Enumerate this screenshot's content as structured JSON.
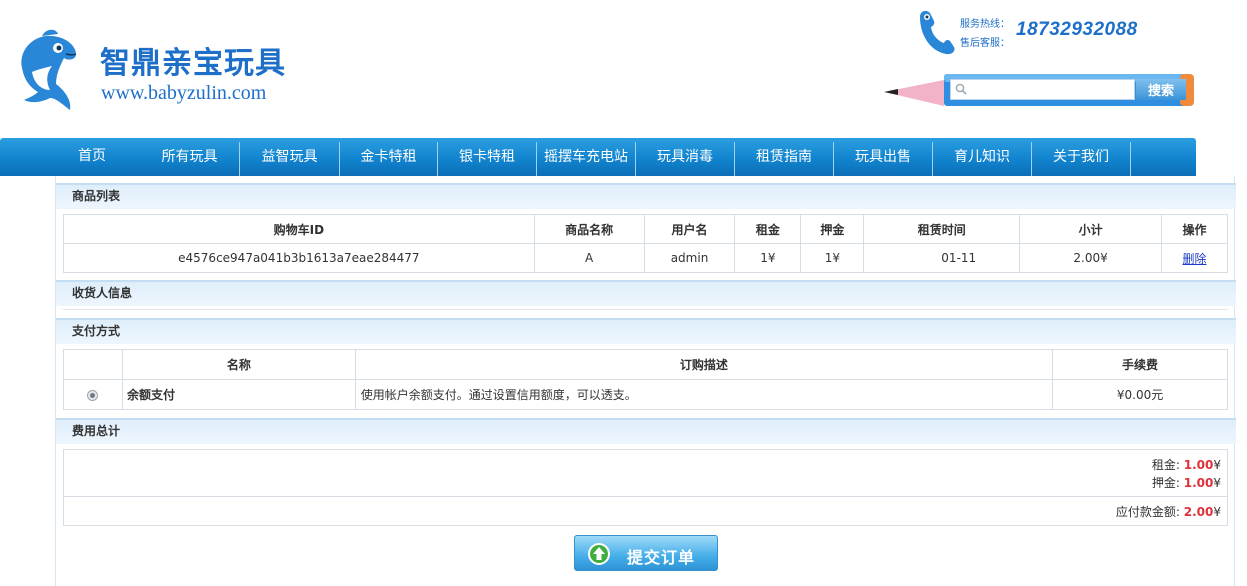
{
  "header": {
    "brand_name": "智鼎亲宝玩具",
    "brand_url": "www.babyzulin.com",
    "hotline_label": "服务热线：",
    "service_label": "售后客服：",
    "phone_number": "18732932088",
    "search": {
      "placeholder": "",
      "button_label": "搜索"
    }
  },
  "nav": {
    "items": [
      {
        "label": "首页"
      },
      {
        "label": "所有玩具"
      },
      {
        "label": "益智玩具"
      },
      {
        "label": "金卡特租"
      },
      {
        "label": "银卡特租"
      },
      {
        "label": "摇摆车充电站"
      },
      {
        "label": "玩具消毒"
      },
      {
        "label": "租赁指南"
      },
      {
        "label": "玩具出售"
      },
      {
        "label": "育儿知识"
      },
      {
        "label": "关于我们"
      }
    ]
  },
  "cart": {
    "title": "商品列表",
    "columns": [
      "购物车ID",
      "商品名称",
      "用户名",
      "租金",
      "押金",
      "租赁时间",
      "小计",
      "操作"
    ],
    "rows": [
      {
        "id": "e4576ce947a041b3b1613a7eae284477",
        "name": "A",
        "user": "admin",
        "rent": "1¥",
        "deposit": "1¥",
        "time": "01-11",
        "subtotal": "2.00¥",
        "action": "删除"
      }
    ]
  },
  "receiver": {
    "title": "收货人信息"
  },
  "payment": {
    "title": "支付方式",
    "columns": [
      "名称",
      "订购描述",
      "手续费"
    ],
    "rows": [
      {
        "name": "余额支付",
        "desc": "使用帐户余额支付。通过设置信用额度，可以透支。",
        "fee": "¥0.00元"
      }
    ]
  },
  "totals": {
    "title": "费用总计",
    "rent_label": "租金:",
    "rent_value": "1.00",
    "deposit_label": "押金:",
    "deposit_value": "1.00",
    "due_label": "应付款金额:",
    "due_value": "2.00",
    "currency": "¥"
  },
  "submit": {
    "label": "提交订单"
  },
  "colors": {
    "brand_blue": "#1d6fc9",
    "nav_blue": "#1284cf",
    "price_red": "#e0303a"
  }
}
